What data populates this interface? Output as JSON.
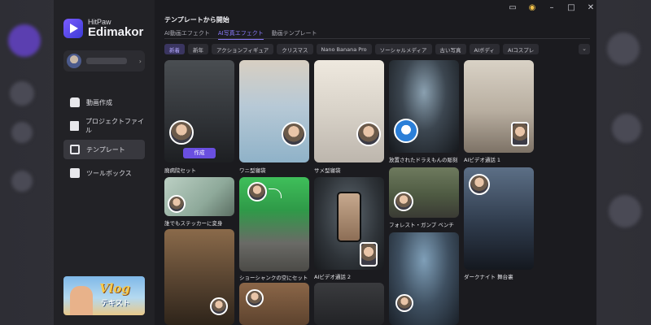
{
  "app": {
    "brand_top": "HitPaw",
    "brand_name": "Edimakor",
    "accent": "#6a4fe0"
  },
  "sidebar": {
    "items": [
      {
        "label": "動画作成",
        "icon": "home-icon"
      },
      {
        "label": "プロジェクトファイル",
        "icon": "folder-plus-icon"
      },
      {
        "label": "テンプレート",
        "icon": "template-icon",
        "active": true
      },
      {
        "label": "ツールボックス",
        "icon": "toolbox-icon"
      }
    ],
    "promo": {
      "title": "Vlog",
      "subtitle": "テキスト"
    }
  },
  "main": {
    "heading": "テンプレートから開始",
    "tabs": [
      {
        "label": "AI動画エフェクト"
      },
      {
        "label": "AI写真エフェクト",
        "active": true
      },
      {
        "label": "動画テンプレート"
      }
    ],
    "chips": [
      "新着",
      "新年",
      "アクションフィギュア",
      "クリスマス",
      "Nano Banana Pro",
      "ソーシャルメディア",
      "古い写真",
      "AIボディ",
      "AIコスプレ"
    ],
    "active_chip": "新着",
    "more_icon": "chevron-down-icon",
    "make_button": "作成"
  },
  "templates": [
    {
      "label": "廃病院セット",
      "col": 0
    },
    {
      "label": "ワニ型寝袋",
      "col": 1
    },
    {
      "label": "サメ型寝袋",
      "col": 2
    },
    {
      "label": "放置されたドラえもんの彫刻",
      "col": 3
    },
    {
      "label": "AIビデオ通話 1",
      "col": 4
    },
    {
      "label": "誰でもステッカーに変身",
      "col": 0
    },
    {
      "label": "ショーシャンクの空にセット",
      "col": 1
    },
    {
      "label": "AIビデオ通話 2",
      "col": 2
    },
    {
      "label": "フォレスト・ガンプ ベンチ",
      "col": 3
    },
    {
      "label": "ダークナイト 舞台裏",
      "col": 4
    }
  ],
  "window_controls": [
    "chat-icon",
    "bell-icon",
    "minimize-icon",
    "maximize-icon",
    "close-icon"
  ]
}
